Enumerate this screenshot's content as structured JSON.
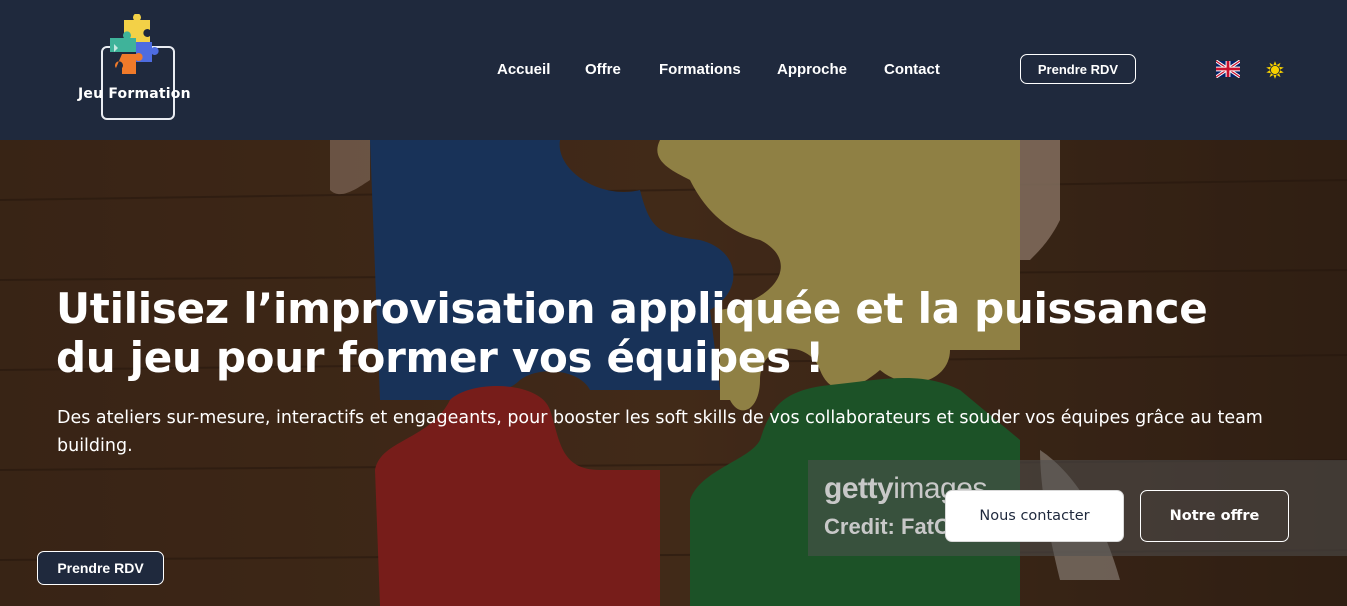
{
  "header": {
    "logo_text": "Jeu Formation",
    "nav": [
      {
        "label": "Accueil"
      },
      {
        "label": "Offre"
      },
      {
        "label": "Formations"
      },
      {
        "label": "Approche"
      },
      {
        "label": "Contact"
      }
    ],
    "rdv_label": "Prendre RDV",
    "language_icon": "uk-flag-icon",
    "theme_icon": "sun-icon"
  },
  "hero": {
    "title": "Utilisez l’improvisation appliquée et la puissance du jeu pour former vos équipes !",
    "subtitle": "Des ateliers sur-mesure, interactifs et engageants, pour booster les soft skills de vos collaborateurs et souder vos équipes grâce au team building.",
    "watermark_brand_bold": "getty",
    "watermark_brand_light": "images",
    "watermark_credit": "Credit: FatC",
    "contact_button": "Nous contacter",
    "offer_button": "Notre offre"
  },
  "floating": {
    "rdv_label": "Prendre RDV"
  },
  "colors": {
    "navbar": "#1f293d",
    "puzzle_blue": "#27528f",
    "puzzle_yellow": "#e7cf6e",
    "puzzle_red": "#c0302b",
    "puzzle_green": "#2e8540",
    "wood": "#5a3a24"
  }
}
